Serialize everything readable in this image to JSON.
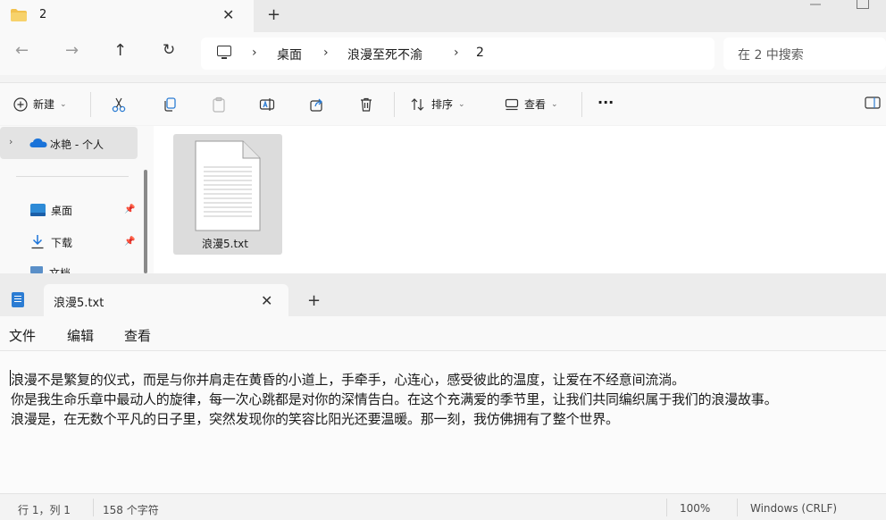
{
  "explorer": {
    "tab_title": "2",
    "breadcrumbs": [
      "桌面",
      "浪漫至死不渝",
      "2"
    ],
    "search_placeholder": "在 2 中搜索",
    "toolbar": {
      "new_label": "新建",
      "sort_label": "排序",
      "view_label": "查看",
      "more_label": "···"
    },
    "sidebar": {
      "onedrive_label": "冰艳 - 个人",
      "items": [
        {
          "label": "桌面"
        },
        {
          "label": "下载"
        },
        {
          "label": "文档"
        }
      ]
    },
    "files": [
      {
        "name": "浪漫5.txt"
      }
    ]
  },
  "notepad": {
    "tab_title": "浪漫5.txt",
    "menu": [
      "文件",
      "编辑",
      "查看"
    ],
    "lines": [
      "浪漫不是繁复的仪式，而是与你并肩走在黄昏的小道上，手牵手，心连心，感受彼此的温度，让爱在不经意间流淌。",
      "你是我生命乐章中最动人的旋律，每一次心跳都是对你的深情告白。在这个充满爱的季节里，让我们共同编织属于我们的浪漫故事。",
      "浪漫是，在无数个平凡的日子里，突然发现你的笑容比阳光还要温暖。那一刻，我仿佛拥有了整个世界。"
    ],
    "status": {
      "position": "行 1，列 1",
      "char_count": "158 个字符",
      "zoom": "100%",
      "line_ending": "Windows (CRLF)"
    }
  },
  "colors": {
    "folder": "#f2c14e",
    "onedrive": "#1a73d9",
    "accent": "#2b7cd3"
  }
}
